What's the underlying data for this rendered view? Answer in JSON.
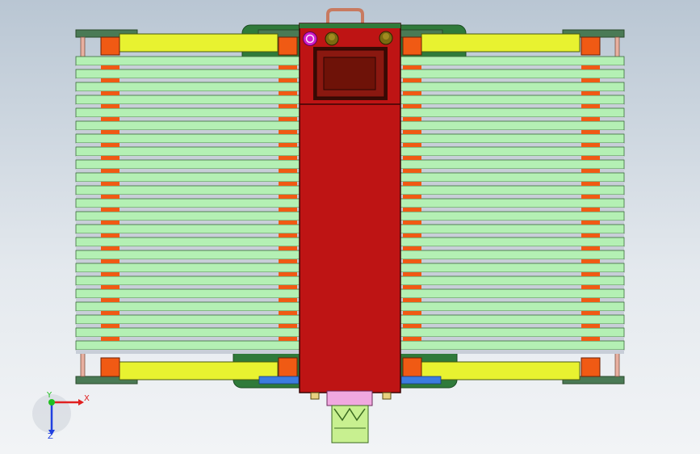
{
  "view": {
    "type": "cad-3d-viewport",
    "orientation": "front",
    "background_top": "#b9c6d3",
    "background_bottom": "#f2f4f6"
  },
  "model": {
    "colors": {
      "plate": "#b4f0b4",
      "plate_edge": "#3a6b3a",
      "yellow_plate": "#e8f230",
      "spacer": "#f05a14",
      "body": "#be1414",
      "panel": "#7a1408",
      "panel_frame": "#3a0a04",
      "bracket": "#2f7a3a",
      "rod": "#e8b0a0",
      "blue_pad": "#3c7ce0",
      "coupler": "#f0a8e0",
      "shaft": "#c8f090",
      "knob_magenta": "#d020c8",
      "knob_olive": "#7a6a10"
    },
    "components": [
      "left-plate-stack",
      "right-plate-stack",
      "main-housing",
      "control-panel",
      "top-handle",
      "bottom-coupler",
      "output-shaft"
    ]
  },
  "triad": {
    "x_label": "X",
    "y_label": "Y",
    "z_label": "Z",
    "x_color": "#e02020",
    "y_color": "#20c020",
    "z_color": "#2040e0"
  }
}
